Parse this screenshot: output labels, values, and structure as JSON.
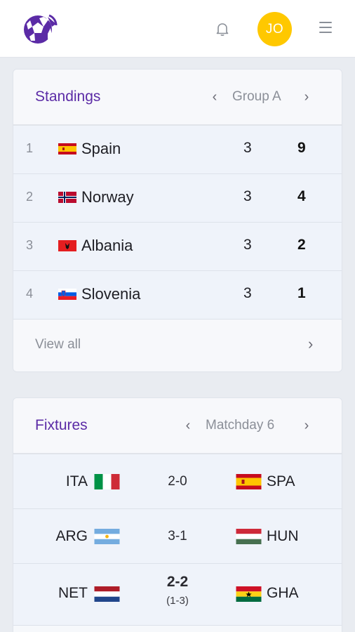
{
  "header": {
    "logo_icon": "soccer-ball-logo-icon",
    "bell_icon": "bell-icon",
    "avatar_initials": "JO",
    "avatar_color": "#ffc800",
    "menu_icon": "hamburger-menu-icon"
  },
  "standings": {
    "title": "Standings",
    "group_label": "Group A",
    "prev_symbol": "‹",
    "next_symbol": "›",
    "rows": [
      {
        "pos": "1",
        "team": "Spain",
        "flag": "spain-flag-icon",
        "played": "3",
        "points": "9"
      },
      {
        "pos": "2",
        "team": "Norway",
        "flag": "norway-flag-icon",
        "played": "3",
        "points": "4"
      },
      {
        "pos": "3",
        "team": "Albania",
        "flag": "albania-flag-icon",
        "played": "3",
        "points": "2"
      },
      {
        "pos": "4",
        "team": "Slovenia",
        "flag": "slovenia-flag-icon",
        "played": "3",
        "points": "1"
      }
    ],
    "view_all_label": "View all",
    "view_all_arrow": "›"
  },
  "fixtures": {
    "title": "Fixtures",
    "matchday_label": "Matchday 6",
    "prev_symbol": "‹",
    "next_symbol": "›",
    "matches": [
      {
        "home": "ITA",
        "home_flag": "italy-flag-icon",
        "score": "2-0",
        "away": "SPA",
        "away_flag": "spain-flag-icon"
      },
      {
        "home": "ARG",
        "home_flag": "argentina-flag-icon",
        "score": "3-1",
        "away": "HUN",
        "away_flag": "hungary-flag-icon"
      },
      {
        "home": "NET",
        "home_flag": "netherlands-flag-icon",
        "score": "2-2",
        "penalties": "(1-3)",
        "away": "GHA",
        "away_flag": "ghana-flag-icon"
      }
    ]
  },
  "colors": {
    "accent": "#5b2ba6",
    "page_background": "#e9ecf1",
    "row_background": "#eff3fa"
  }
}
